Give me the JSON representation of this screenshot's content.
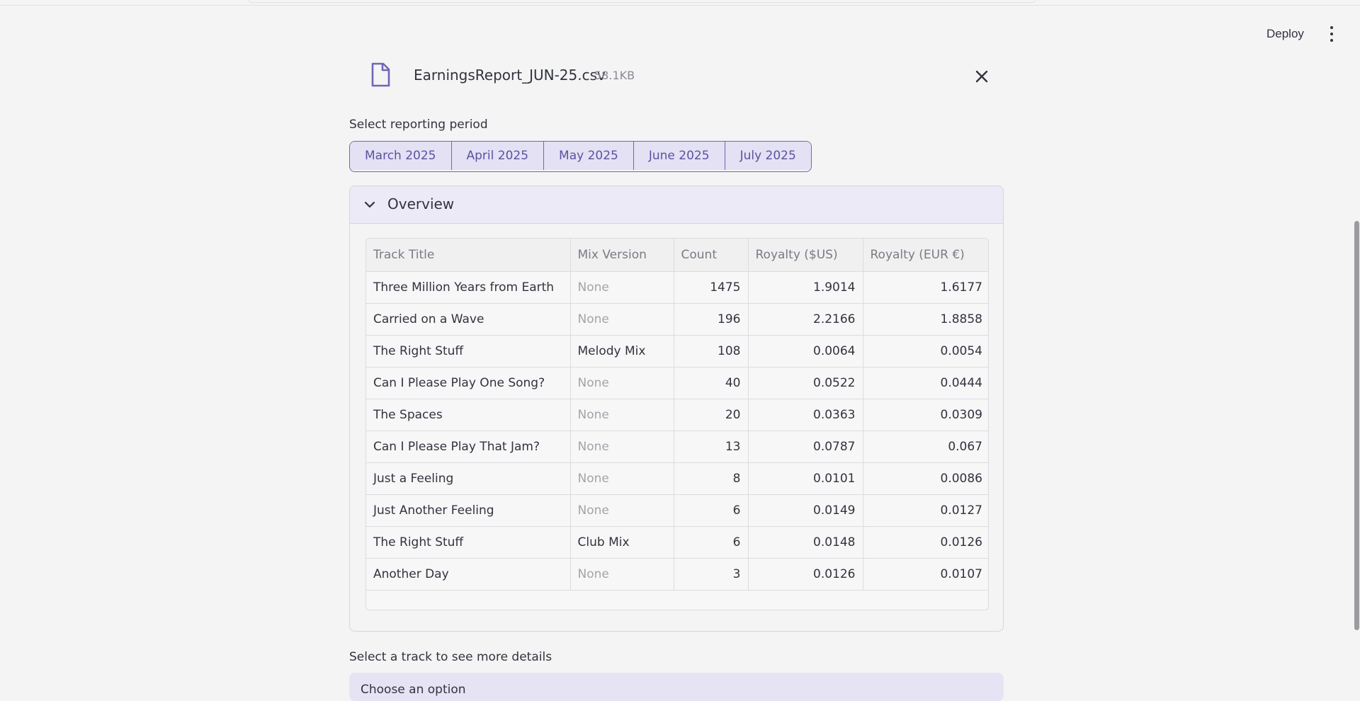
{
  "header": {
    "deploy_label": "Deploy",
    "menu_icon": "kebab-menu-icon"
  },
  "uploaded_file": {
    "name": "EarningsReport_JUN-25.csv",
    "size": "58.1KB",
    "icon": "file-icon",
    "close_icon": "close-icon"
  },
  "period": {
    "label": "Select reporting period",
    "options": [
      "March 2025",
      "April 2025",
      "May 2025",
      "June 2025",
      "July 2025"
    ]
  },
  "overview": {
    "title": "Overview",
    "columns": [
      "Track Title",
      "Mix Version",
      "Count",
      "Royalty ($US)",
      "Royalty (EUR €)"
    ],
    "rows": [
      [
        "Three Million Years from Earth",
        "None",
        "1475",
        "1.9014",
        "1.6177"
      ],
      [
        "Carried on a Wave",
        "None",
        "196",
        "2.2166",
        "1.8858"
      ],
      [
        "The Right Stuff",
        "Melody Mix",
        "108",
        "0.0064",
        "0.0054"
      ],
      [
        "Can I Please Play One Song?",
        "None",
        "40",
        "0.0522",
        "0.0444"
      ],
      [
        "The Spaces",
        "None",
        "20",
        "0.0363",
        "0.0309"
      ],
      [
        "Can I Please Play That Jam?",
        "None",
        "13",
        "0.0787",
        "0.067"
      ],
      [
        "Just a Feeling",
        "None",
        "8",
        "0.0101",
        "0.0086"
      ],
      [
        "Just Another Feeling",
        "None",
        "6",
        "0.0149",
        "0.0127"
      ],
      [
        "The Right Stuff",
        "Club Mix",
        "6",
        "0.0148",
        "0.0126"
      ],
      [
        "Another Day",
        "None",
        "3",
        "0.0126",
        "0.0107"
      ]
    ]
  },
  "details": {
    "label": "Select a track to see more details",
    "placeholder": "Choose an option"
  },
  "colors": {
    "accent": "#5b52a3",
    "segment_bg": "#e3e1f3",
    "expander_head": "#eceaf6",
    "page_bg": "#f4f4f4"
  }
}
